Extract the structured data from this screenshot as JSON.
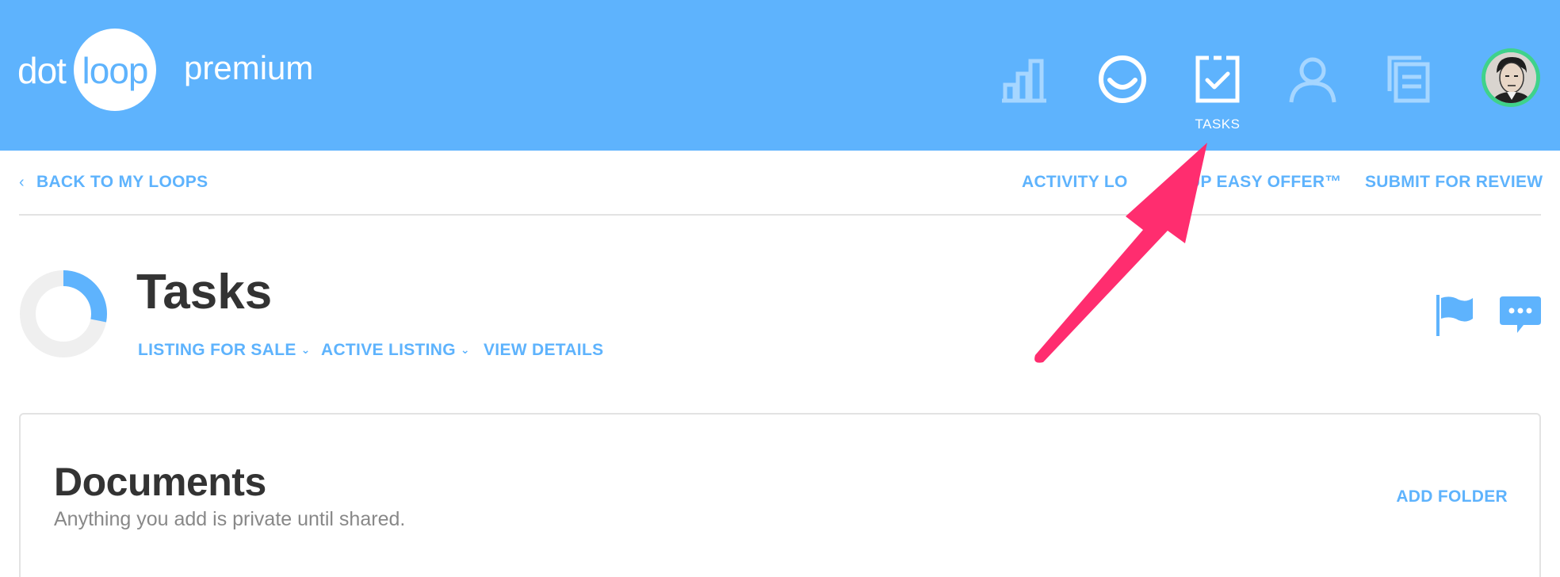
{
  "brand": {
    "dot": "dot",
    "loop": "loop",
    "tier": "premium"
  },
  "header": {
    "nav": [
      {
        "icon": "bar-chart-icon",
        "label": ""
      },
      {
        "icon": "smile-icon",
        "label": ""
      },
      {
        "icon": "tasks-clipboard-icon",
        "label": "TASKS"
      },
      {
        "icon": "person-icon",
        "label": ""
      },
      {
        "icon": "documents-icon",
        "label": ""
      }
    ],
    "avatar": "user-avatar"
  },
  "subnav": {
    "back": "BACK TO MY LOOPS",
    "activity": "ACTIVITY LO",
    "easy_offer": "UP EASY OFFER™",
    "submit": "SUBMIT FOR REVIEW"
  },
  "page": {
    "title": "Tasks",
    "progress_fraction": 0.28,
    "transaction_type": "LISTING FOR SALE",
    "status": "ACTIVE LISTING",
    "view_details": "VIEW DETAILS"
  },
  "documents": {
    "title": "Documents",
    "subtitle": "Anything you add is private until shared.",
    "add_folder": "ADD FOLDER"
  },
  "colors": {
    "header_bg": "#5eb3fd",
    "accent": "#5eb3fd",
    "avatar_ring": "#3fd28b",
    "annotation_arrow": "#ff2d6f",
    "donut_track": "#efefef"
  }
}
